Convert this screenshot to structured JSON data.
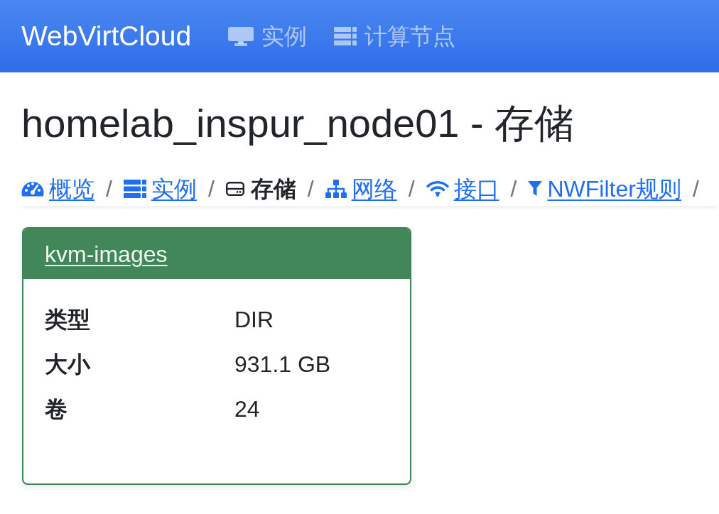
{
  "navbar": {
    "brand": "WebVirtCloud",
    "items": [
      {
        "label": "实例"
      },
      {
        "label": "计算节点"
      }
    ]
  },
  "page_title": "homelab_inspur_node01 - 存储",
  "breadcrumb": {
    "items": [
      {
        "label": "概览",
        "selected": false,
        "separator": "/"
      },
      {
        "label": "实例",
        "selected": false,
        "separator": "/"
      },
      {
        "label": "存储",
        "selected": true,
        "separator": "/"
      },
      {
        "label": "网络",
        "selected": false,
        "separator": "/"
      },
      {
        "label": "接口",
        "selected": false,
        "separator": "/"
      },
      {
        "label": "NWFilter规则",
        "selected": false,
        "separator": "/"
      }
    ]
  },
  "pools": [
    {
      "name": "kvm-images",
      "rows": [
        {
          "label": "类型",
          "value": "DIR"
        },
        {
          "label": "大小",
          "value": "931.1 GB"
        },
        {
          "label": "卷",
          "value": "24"
        }
      ]
    }
  ]
}
